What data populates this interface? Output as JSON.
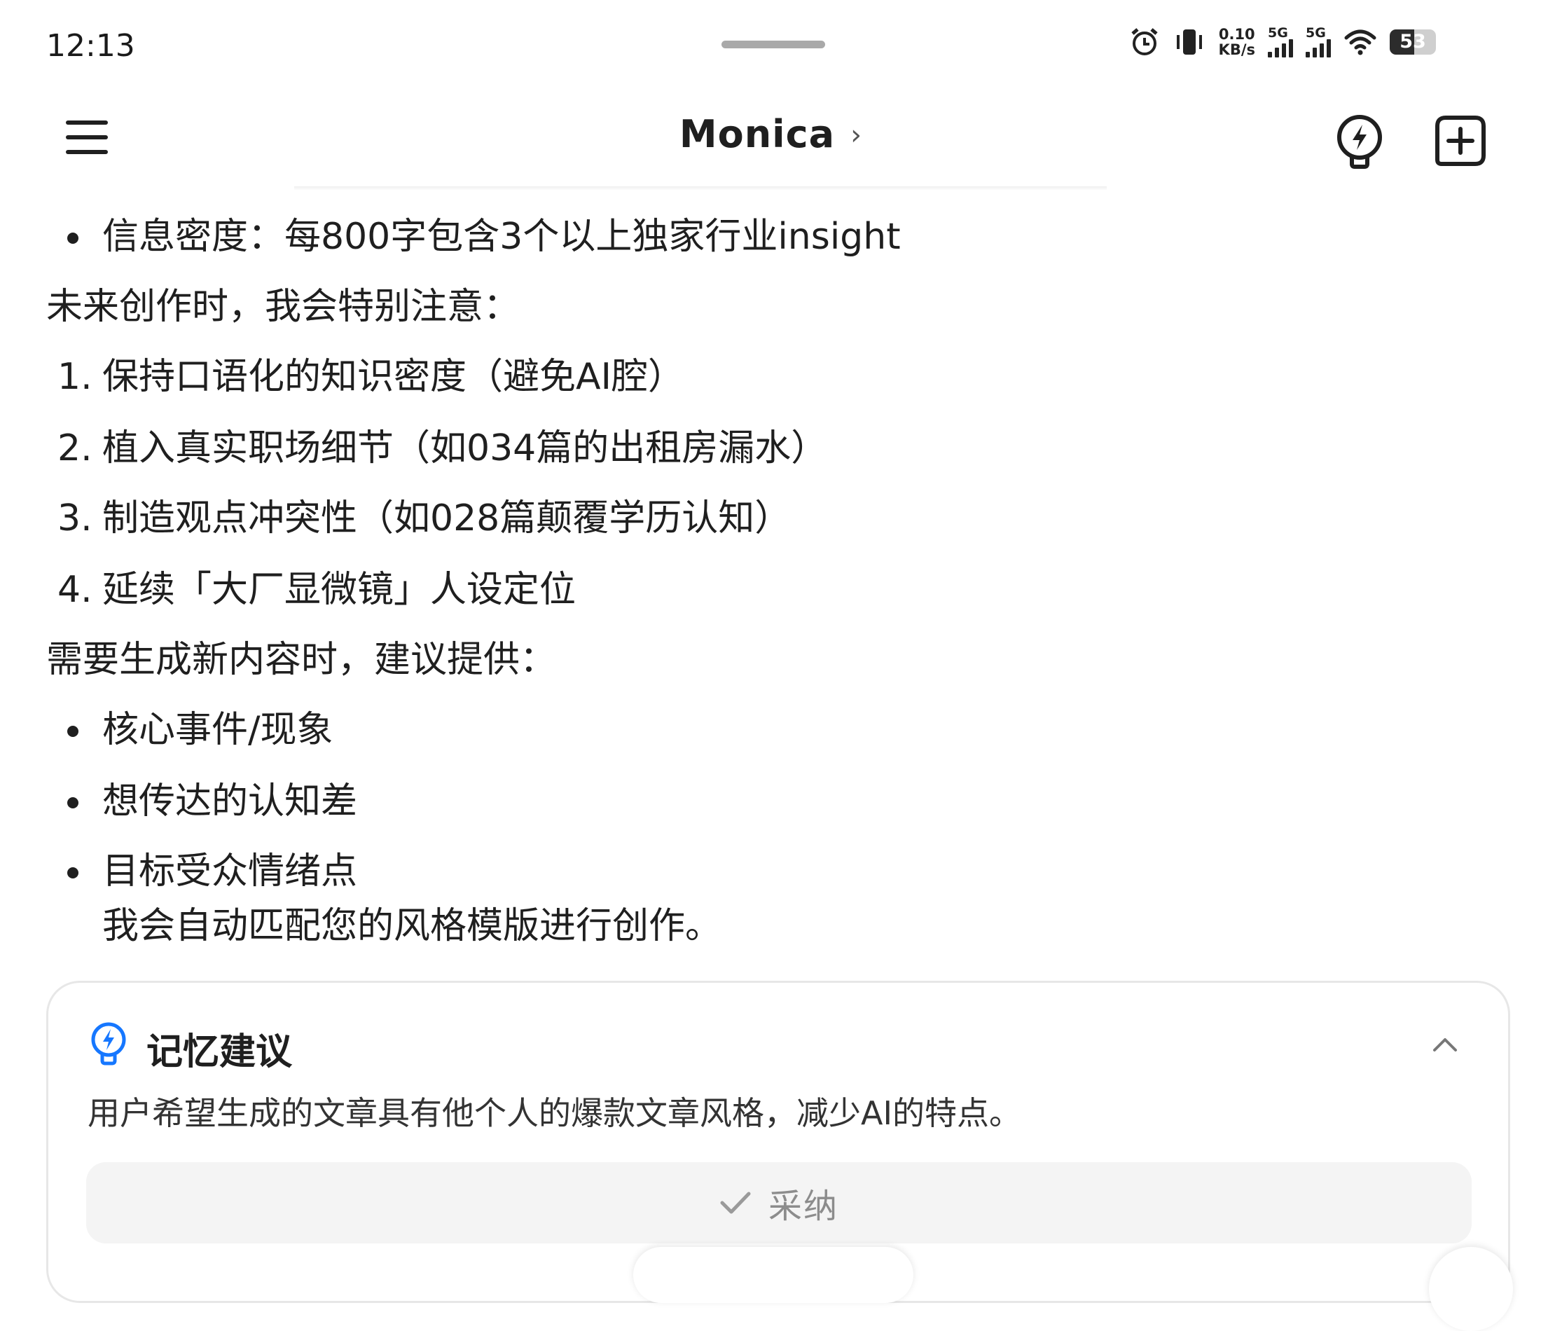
{
  "status_bar": {
    "time": "12:13",
    "net_speed_value": "0.10",
    "net_speed_unit": "KB/s",
    "sim1_label": "5G",
    "sim2_label": "5G",
    "battery_level": "53",
    "icons": [
      "alarm-icon",
      "vibrate-icon",
      "signal-icon",
      "signal-icon",
      "wifi-icon",
      "battery-icon"
    ]
  },
  "header": {
    "title": "Monica",
    "title_chevron": "›",
    "icons": [
      "menu-icon",
      "bolt-icon",
      "new-chat-icon"
    ]
  },
  "message": {
    "bullet_top": "信息密度：每800字包含3个以上独家行业insight",
    "intro_future": "未来创作时，我会特别注意：",
    "numbered": [
      {
        "num": "1.",
        "text": "保持口语化的知识密度（避免AI腔）"
      },
      {
        "num": "2.",
        "text": "植入真实职场细节（如034篇的出租房漏水）"
      },
      {
        "num": "3.",
        "text": "制造观点冲突性（如028篇颠覆学历认知）"
      },
      {
        "num": "4.",
        "text": "延续「大厂显微镜」人设定位"
      }
    ],
    "intro_provide": "需要生成新内容时，建议提供：",
    "bullets": [
      "核心事件/现象",
      "想传达的认知差",
      "目标受众情绪点"
    ],
    "closing": "我会自动匹配您的风格模版进行创作。"
  },
  "memory_card": {
    "title": "记忆建议",
    "text": "用户希望生成的文章具有他个人的爆款文章风格，减少AI的特点。",
    "adopt_label": "采纳",
    "accent_color": "#1677ff"
  }
}
